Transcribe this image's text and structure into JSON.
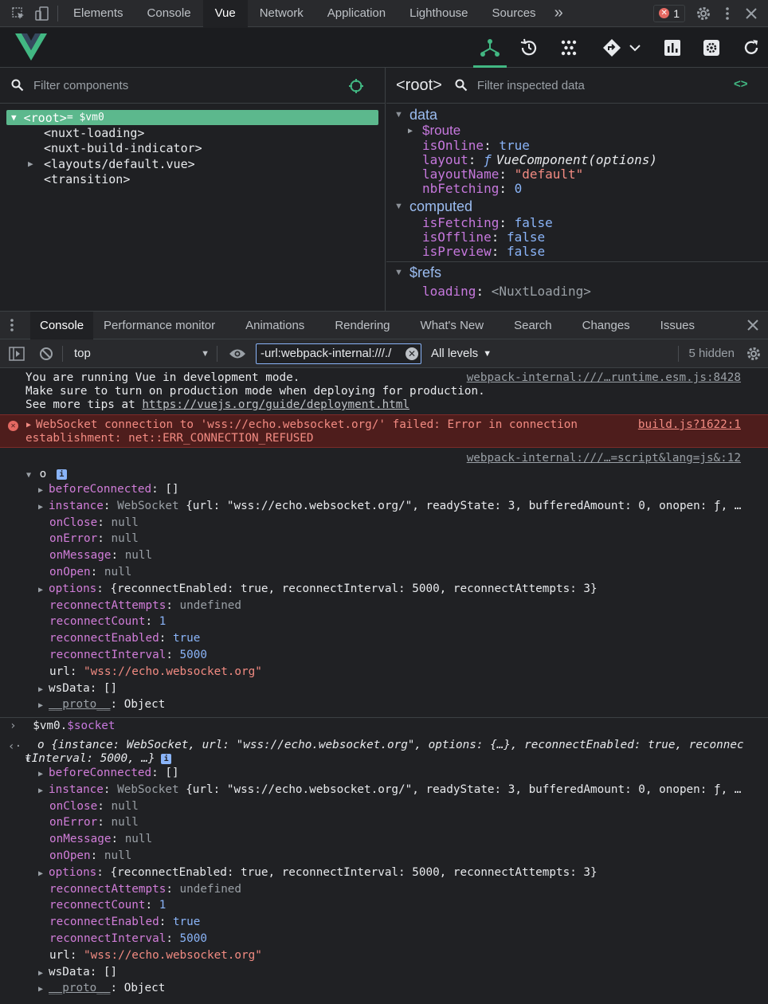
{
  "devtools": {
    "tabs": [
      "Elements",
      "Console",
      "Vue",
      "Network",
      "Application",
      "Lighthouse",
      "Sources"
    ],
    "more": "»",
    "error_count": "1",
    "icons": [
      "inspect-icon",
      "device-icon",
      "settings-icon",
      "kebab-icon",
      "close-icon"
    ]
  },
  "vue": {
    "filter_components_placeholder": "Filter components",
    "tree": [
      {
        "label": "<root>",
        "suffix": " = $vm0",
        "selected": true
      },
      {
        "label": "<nuxt-loading>"
      },
      {
        "label": "<nuxt-build-indicator>"
      },
      {
        "label": "<layouts/default.vue>",
        "expandable": true
      },
      {
        "label": "<transition>"
      }
    ],
    "inspector": {
      "title": "<root>",
      "filter_placeholder": "Filter inspected data",
      "code_icon": "<>",
      "data_label": "data",
      "computed_label": "computed",
      "refs_label": "$refs",
      "data": {
        "route_key": "$route",
        "isOnline": "true",
        "layout_fn": "ƒ",
        "layout_value": "VueComponent(options)",
        "layoutName": "\"default\"",
        "nbFetching": "0"
      },
      "computed": {
        "isFetching": "false",
        "isOffline": "false",
        "isPreview": "false"
      },
      "refs": {
        "loading": "<NuxtLoading>"
      }
    }
  },
  "drawer": {
    "tabs": [
      "Console",
      "Performance monitor",
      "Animations",
      "Rendering",
      "What's New",
      "Search",
      "Changes",
      "Issues"
    ]
  },
  "console_toolbar": {
    "context": "top",
    "filter_value": "-url:webpack-internal:///./",
    "levels": "All levels",
    "hidden": "5 hidden"
  },
  "console": {
    "vue_msg_1": "You are running Vue in development mode.",
    "vue_msg_2": "Make sure to turn on production mode when deploying for production.",
    "vue_msg_3a": "See more tips at ",
    "vue_msg_3b": "https://vuejs.org/guide/deployment.html",
    "vue_src": "webpack-internal:///…runtime.esm.js:8428",
    "error_1": "WebSocket connection to 'wss://echo.websocket.org/' failed: Error in connection",
    "error_2": "establishment: net::ERR_CONNECTION_REFUSED",
    "error_src": "build.js?1622:1",
    "log_src": "webpack-internal:///…=script&lang=js&:12",
    "obj_label": "o",
    "info_badge": "i",
    "prompt_input": "$vm0.$socket",
    "result_summary_1": "o {instance: WebSocket, url: \"wss://echo.websocket.org\", options: {…}, reconnectEnabled: true, reconnec",
    "result_summary_2": "tInterval: 5000, …}",
    "props": {
      "beforeConnected": "[]",
      "instance_type": "WebSocket",
      "instance_preview": "{url: \"wss://echo.websocket.org/\", readyState: 3, bufferedAmount: 0, onopen: ƒ, …",
      "onClose": "null",
      "onError": "null",
      "onMessage": "null",
      "onOpen": "null",
      "options": "{reconnectEnabled: true, reconnectInterval: 5000, reconnectAttempts: 3}",
      "reconnectAttempts": "undefined",
      "reconnectCount": "1",
      "reconnectEnabled": "true",
      "reconnectInterval": "5000",
      "url": "\"wss://echo.websocket.org\"",
      "wsData": "[]",
      "proto": "Object"
    }
  },
  "colors": {
    "vue_green": "#42b883",
    "error_bg": "#4e1d1c",
    "key_purple": "#c678dd",
    "bool_blue": "#8ab4f8",
    "string_red": "#f28b82"
  }
}
